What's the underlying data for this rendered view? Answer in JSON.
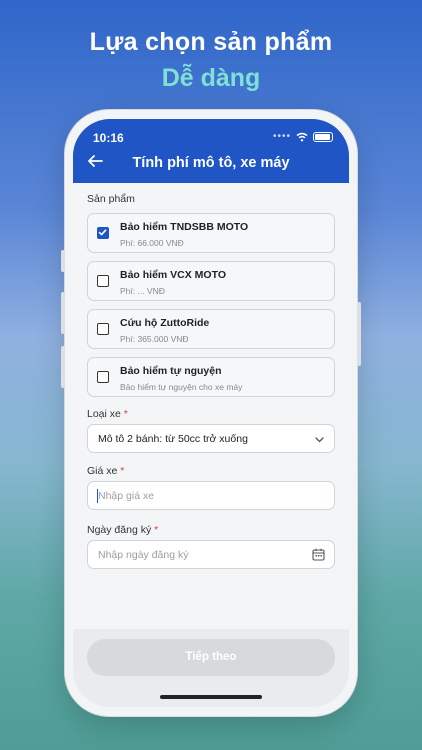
{
  "promo": {
    "headline": "Lựa chọn sản phẩm",
    "subheadline": "Dễ dàng"
  },
  "status_bar": {
    "time": "10:16",
    "icons": [
      "signal-dots-icon",
      "wifi-icon",
      "battery-icon"
    ]
  },
  "header": {
    "title": "Tính phí mô tô, xe máy",
    "back_icon": "back-arrow-icon"
  },
  "products": {
    "label": "Sản phẩm",
    "items": [
      {
        "title": "Bảo hiểm TNDSBB MOTO",
        "subtitle": "Phí: 66.000 VNĐ",
        "checked": true
      },
      {
        "title": "Bảo hiểm VCX MOTO",
        "subtitle": "Phí: ... VNĐ",
        "checked": false
      },
      {
        "title": "Cứu hộ ZuttoRide",
        "subtitle": "Phí: 365.000 VNĐ",
        "checked": false
      },
      {
        "title": "Bảo hiểm tự nguyện",
        "subtitle": "Bảo hiểm tự nguyện cho xe máy",
        "checked": false
      }
    ]
  },
  "vehicle_type": {
    "label": "Loại xe",
    "required_mark": "*",
    "value": "Mô tô 2 bánh: từ 50cc trở xuống"
  },
  "vehicle_price": {
    "label": "Giá xe",
    "required_mark": "*",
    "placeholder": "Nhập giá xe",
    "value": ""
  },
  "registration_date": {
    "label": "Ngày đăng ký",
    "required_mark": "*",
    "placeholder": "Nhập ngày đăng ký",
    "value": ""
  },
  "footer": {
    "next_label": "Tiếp theo"
  },
  "colors": {
    "primary": "#1f55c4",
    "accent_text": "#7fe0d6",
    "required": "#e23b3b",
    "disabled_button": "#d7d9dd"
  }
}
